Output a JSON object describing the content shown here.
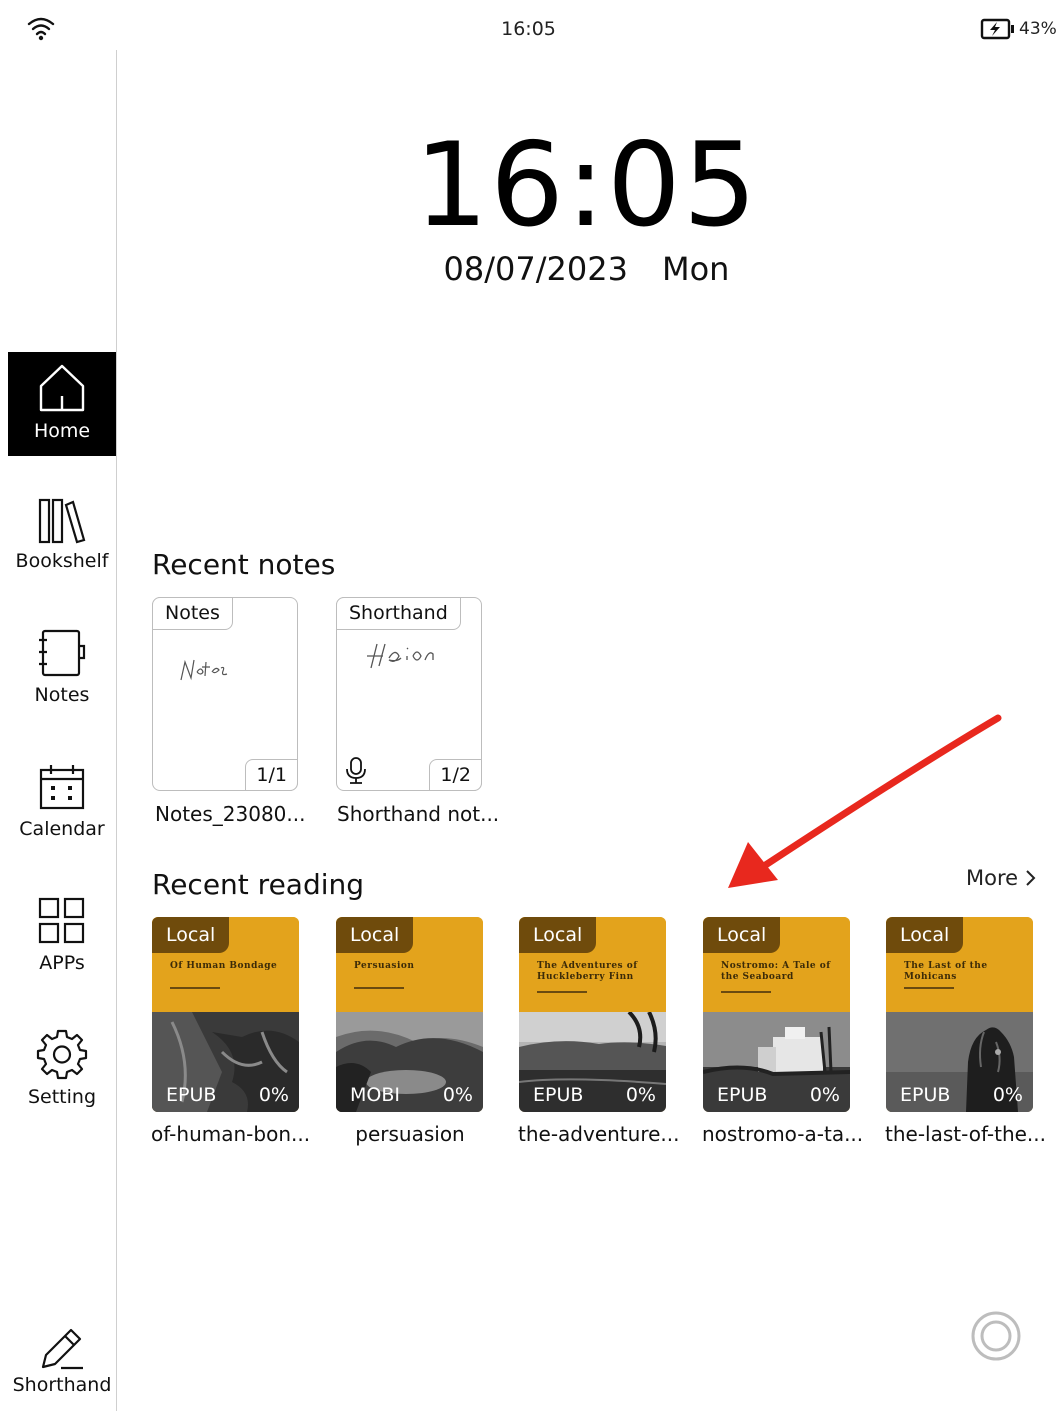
{
  "status": {
    "time": "16:05",
    "battery": "43%"
  },
  "sidebar": {
    "items": [
      {
        "label": "Home",
        "icon": "home-icon",
        "active": true
      },
      {
        "label": "Bookshelf",
        "icon": "bookshelf-icon"
      },
      {
        "label": "Notes",
        "icon": "notes-icon"
      },
      {
        "label": "Calendar",
        "icon": "calendar-icon"
      },
      {
        "label": "APPs",
        "icon": "apps-grid-icon"
      },
      {
        "label": "Setting",
        "icon": "gear-icon"
      },
      {
        "label": "Shorthand",
        "icon": "pen-icon"
      }
    ]
  },
  "clock": {
    "time": "16:05",
    "date": "08/07/2023",
    "weekday": "Mon"
  },
  "recent_notes": {
    "title": "Recent notes",
    "items": [
      {
        "tag": "Notes",
        "pages": "1/1",
        "name": "Notes_23080...",
        "has_mic": false
      },
      {
        "tag": "Shorthand",
        "pages": "1/2",
        "name": "Shorthand not...",
        "has_mic": true
      }
    ]
  },
  "recent_reading": {
    "title": "Recent reading",
    "more_label": "More",
    "books": [
      {
        "tag": "Local",
        "cover_title": "Of Human Bondage",
        "format": "EPUB",
        "progress": "0%",
        "name": "of-human-bon..."
      },
      {
        "tag": "Local",
        "cover_title": "Persuasion",
        "format": "MOBI",
        "progress": "0%",
        "name": "persuasion"
      },
      {
        "tag": "Local",
        "cover_title": "The Adventures of Huckleberry Finn",
        "format": "EPUB",
        "progress": "0%",
        "name": "the-adventure..."
      },
      {
        "tag": "Local",
        "cover_title": "Nostromo: A Tale of the Seaboard",
        "format": "EPUB",
        "progress": "0%",
        "name": "nostromo-a-ta..."
      },
      {
        "tag": "Local",
        "cover_title": "The Last of the Mohicans",
        "format": "EPUB",
        "progress": "0%",
        "name": "the-last-of-the..."
      }
    ]
  },
  "colors": {
    "cover_accent": "#e3a31c",
    "tag_bg": "#6f4b0c",
    "annotation_arrow": "#e8281e"
  }
}
